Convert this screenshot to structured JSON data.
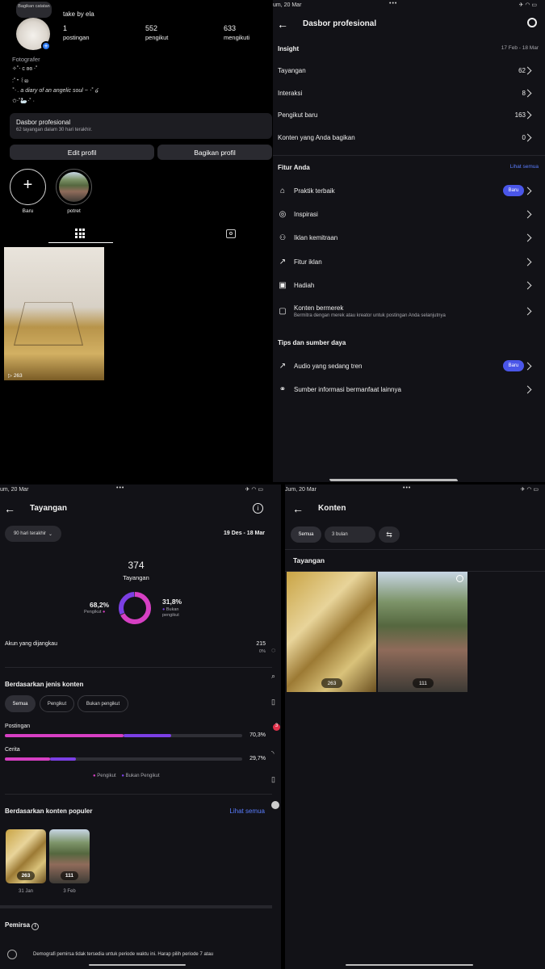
{
  "profile": {
    "note_bubble": "Bagikan catatan",
    "username": "take by ela",
    "posts_value": "1",
    "posts_label": "postingan",
    "followers_value": "552",
    "followers_label": "pengikut",
    "following_value": "633",
    "following_label": "mengikuti",
    "category": "Fotografer",
    "bio_line1": "✧˚‧ c ʚɞ ‧˚",
    "bio_line2": ":˚‧꒰ఐ",
    "bio_line3": "˚‧ . a diary of an angelic soul ~ ‧˚ ໒",
    "bio_line4": "✩‧˚🦢‧˚ ·",
    "dash_title": "Dasbor profesional",
    "dash_sub": "62 tayangan dalam 30 hari terakhir.",
    "edit_label": "Edit profil",
    "share_label": "Bagikan profil",
    "highlight_new": "Baru",
    "highlight_1": "potret",
    "post_views": "263"
  },
  "dashboard": {
    "status_time": "um, 20 Mar",
    "title": "Dasbor profesional",
    "insight_heading": "Insight",
    "date_range": "17 Feb - 18 Mar",
    "rows": [
      {
        "label": "Tayangan",
        "value": "62"
      },
      {
        "label": "Interaksi",
        "value": "8"
      },
      {
        "label": "Pengikut baru",
        "value": "163"
      },
      {
        "label": "Konten yang Anda bagikan",
        "value": "0"
      }
    ],
    "features_heading": "Fitur Anda",
    "see_all": "Lihat semua",
    "features": [
      {
        "label": "Praktik terbaik",
        "sub": "",
        "badge": "Baru"
      },
      {
        "label": "Inspirasi",
        "sub": "",
        "badge": ""
      },
      {
        "label": "Iklan kemitraan",
        "sub": "",
        "badge": ""
      },
      {
        "label": "Fitur iklan",
        "sub": "",
        "badge": ""
      },
      {
        "label": "Hadiah",
        "sub": "",
        "badge": ""
      },
      {
        "label": "Konten bermerek",
        "sub": "Bermitra dengan merek atau kreator untuk postingan Anda selanjutnya",
        "badge": ""
      }
    ],
    "tips_heading": "Tips dan sumber daya",
    "tips": [
      {
        "label": "Audio yang sedang tren",
        "badge": "Baru"
      },
      {
        "label": "Sumber informasi bermanfaat lainnya",
        "badge": ""
      }
    ]
  },
  "views": {
    "status_time": "um, 20 Mar",
    "title": "Tayangan",
    "period_filter": "90 hari terakhir",
    "date_range": "19 Des - 18 Mar",
    "total": "374",
    "total_label": "Tayangan",
    "followers_pct": "68,2%",
    "followers_label": "Pengikut",
    "nonfollowers_pct": "31,8%",
    "nonfollowers_label": "Bukan pengikut",
    "reached_label": "Akun yang dijangkau",
    "reached_value": "215",
    "reached_pct": "0%",
    "by_type_heading": "Berdasarkan jenis konten",
    "tabs": [
      "Semua",
      "Pengikut",
      "Bukan pengikut"
    ],
    "type_rows": [
      {
        "label": "Postingan",
        "pct": "70,3%",
        "followers": 0.5,
        "nonfollowers": 0.2
      },
      {
        "label": "Cerita",
        "pct": "29,7%",
        "followers": 0.19,
        "nonfollowers": 0.11
      }
    ],
    "legend_followers": "Pengikut",
    "legend_nonfollowers": "Bukan Pengikut",
    "popular_heading": "Berdasarkan konten populer",
    "popular_see_all": "Lihat semua",
    "popular": [
      {
        "views": "263",
        "date": "31 Jan"
      },
      {
        "views": "111",
        "date": "3 Feb"
      }
    ],
    "audience_heading": "Pemirsa",
    "audience_note": "Demografi pemirsa tidak tersedia untuk periode waktu ini. Harap pilih periode 7 atau"
  },
  "content": {
    "status_time": "Jum, 20 Mar",
    "status_left": "41",
    "title": "Konten",
    "filter_all": "Semua",
    "filter_period": "3 bulan",
    "section": "Tayangan",
    "items": [
      {
        "views": "263"
      },
      {
        "views": "111"
      }
    ]
  },
  "colors": {
    "accent": "#4a56e8",
    "pink": "#d63fc3",
    "purple": "#7b3fe4",
    "link": "#5a7dff"
  }
}
